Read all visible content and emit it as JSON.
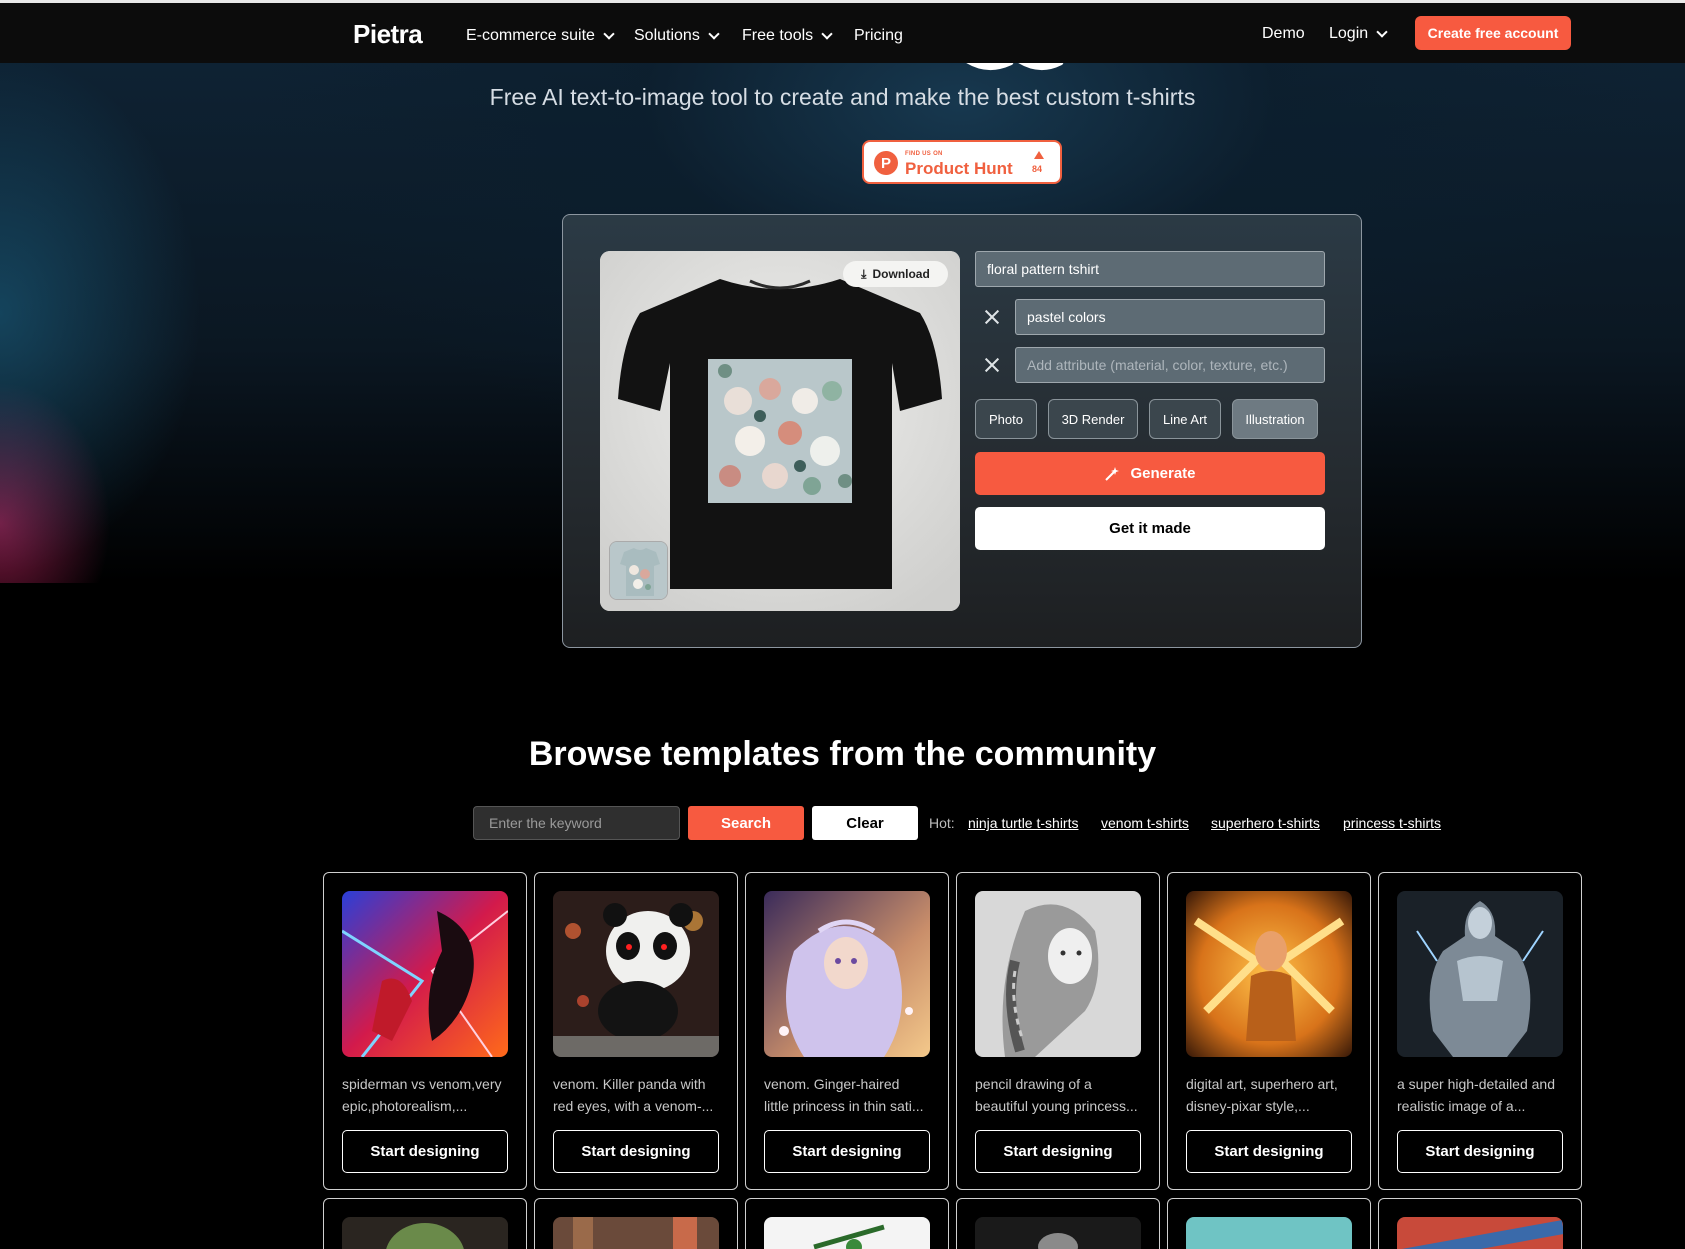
{
  "nav": {
    "logo": "Pietra",
    "items": [
      "E-commerce suite",
      "Solutions",
      "Free tools",
      "Pricing"
    ],
    "demo": "Demo",
    "login": "Login",
    "cta": "Create free account"
  },
  "hero": {
    "subtitle": "Free AI text-to-image tool to create and make the best custom t-shirts",
    "product_hunt": {
      "small_text": "FIND US ON",
      "name": "Product Hunt",
      "count": "84"
    }
  },
  "generator": {
    "download_label": "Download",
    "prompt_value": "floral pattern tshirt",
    "attribute_value": "pastel colors",
    "attribute_placeholder": "Add attribute (material, color, texture, etc.)",
    "styles": [
      "Photo",
      "3D Render",
      "Line Art",
      "Illustration"
    ],
    "active_style": "Illustration",
    "generate_label": "Generate",
    "get_made_label": "Get it made"
  },
  "browse": {
    "title": "Browse templates from the community",
    "search_placeholder": "Enter the keyword",
    "search_label": "Search",
    "clear_label": "Clear",
    "hot_label": "Hot:",
    "hot_links": [
      "ninja turtle t-shirts",
      "venom t-shirts",
      "superhero t-shirts",
      "princess t-shirts"
    ],
    "cards": [
      {
        "desc1": "spiderman vs venom,very",
        "desc2": "epic,photorealism,...",
        "button": "Start designing"
      },
      {
        "desc1": "venom. Killer panda with",
        "desc2": "red eyes, with a venom-...",
        "button": "Start designing"
      },
      {
        "desc1": "venom. Ginger-haired",
        "desc2": "little princess in thin sati...",
        "button": "Start designing"
      },
      {
        "desc1": "pencil drawing of a",
        "desc2": "beautiful young princess...",
        "button": "Start designing"
      },
      {
        "desc1": "digital art, superhero art,",
        "desc2": "disney-pixar style,...",
        "button": "Start designing"
      },
      {
        "desc1": "a super high-detailed and",
        "desc2": "realistic image of a...",
        "button": "Start designing"
      }
    ]
  },
  "colors": {
    "accent": "#f75a40",
    "panel_border": "#8c96a0",
    "field_bg": "#5d6b74"
  }
}
